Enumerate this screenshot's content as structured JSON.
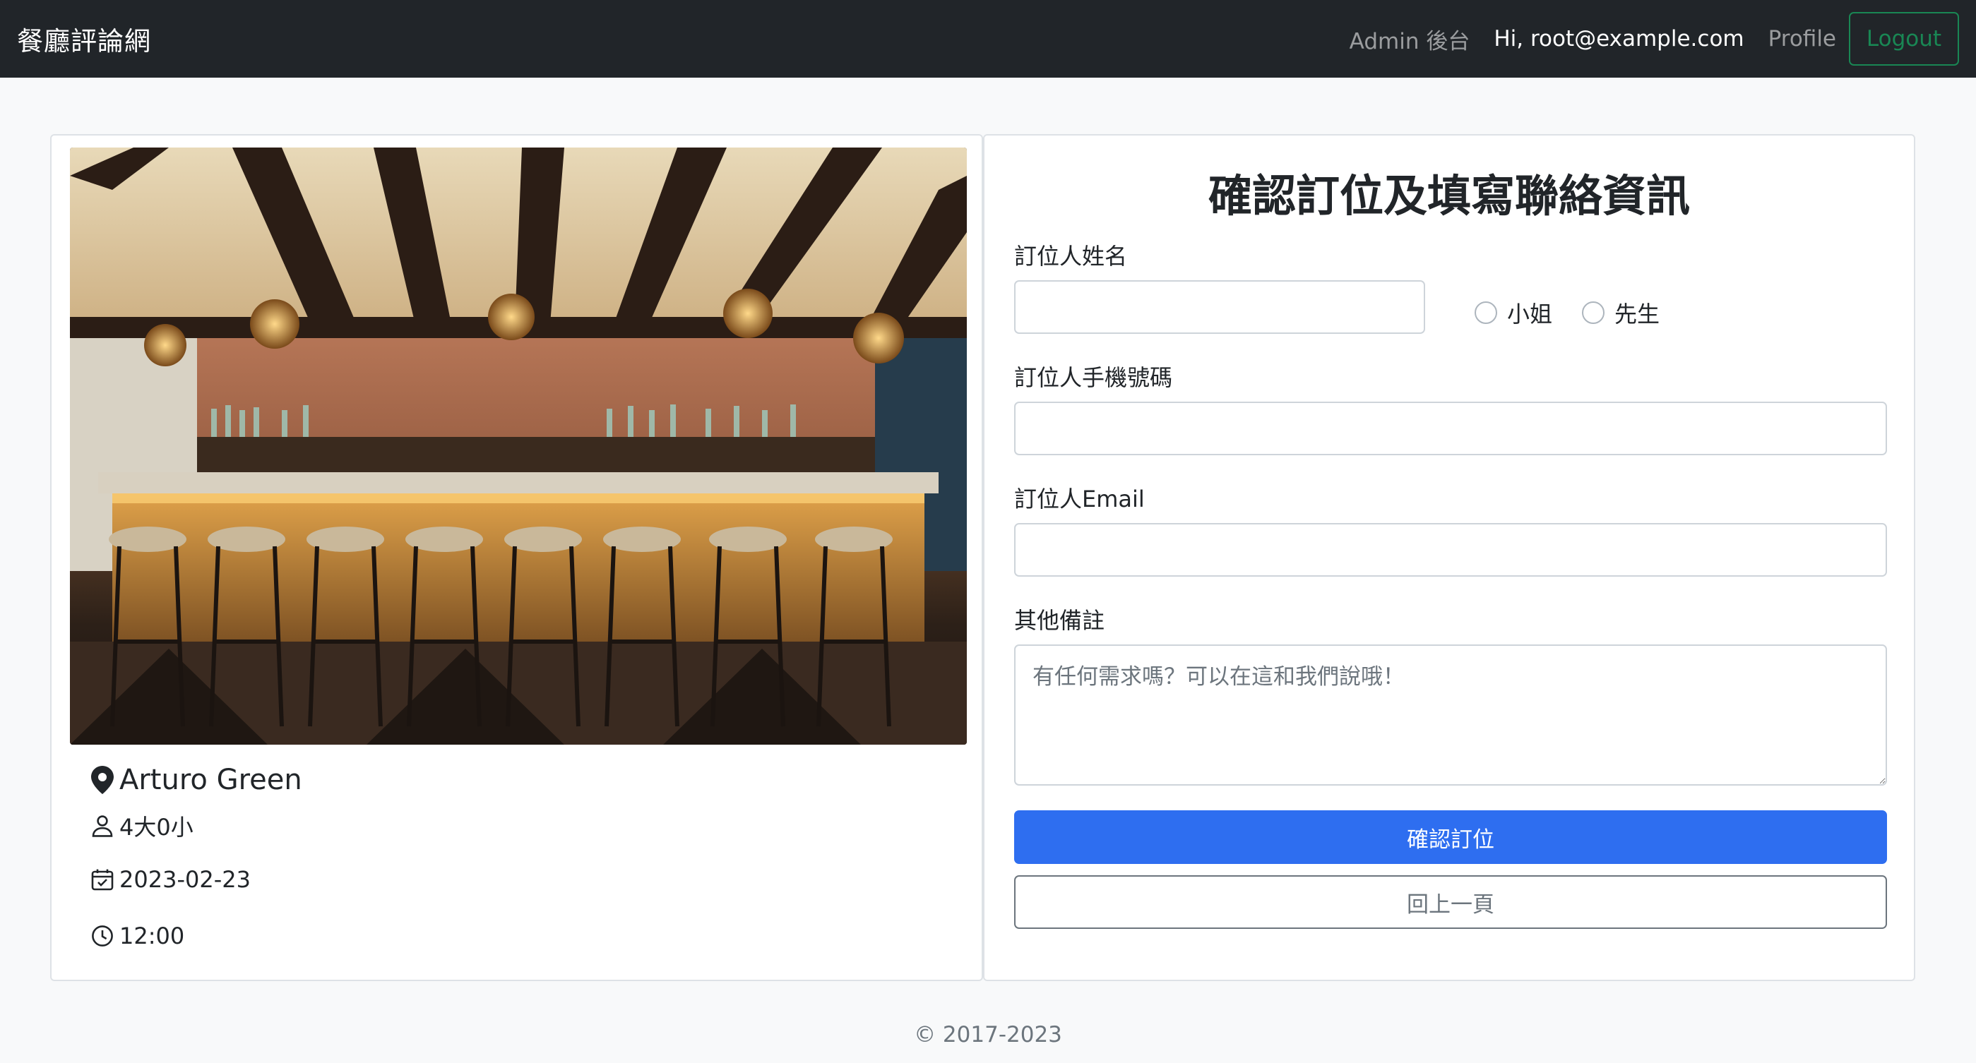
{
  "navbar": {
    "brand": "餐廳評論網",
    "admin_link": "Admin 後台",
    "greeting": "Hi, root@example.com",
    "profile_link": "Profile",
    "logout_label": "Logout"
  },
  "reservation": {
    "restaurant_name": "Arturo Green",
    "guests": "4大0小",
    "date": "2023-02-23",
    "time": "12:00"
  },
  "form": {
    "title": "確認訂位及填寫聯絡資訊",
    "name_label": "訂位人姓名",
    "name_value": "",
    "gender_options": [
      "小姐",
      "先生"
    ],
    "phone_label": "訂位人手機號碼",
    "phone_value": "",
    "email_label": "訂位人Email",
    "email_value": "",
    "notes_label": "其他備註",
    "notes_placeholder": "有任何需求嗎？可以在這和我們說哦！",
    "submit_label": "確認訂位",
    "back_label": "回上一頁"
  },
  "footer": {
    "copyright": "© 2017-2023"
  },
  "colors": {
    "navbar_bg": "#212529",
    "primary": "#2e6ef0",
    "success": "#198754",
    "secondary": "#6c757d"
  }
}
